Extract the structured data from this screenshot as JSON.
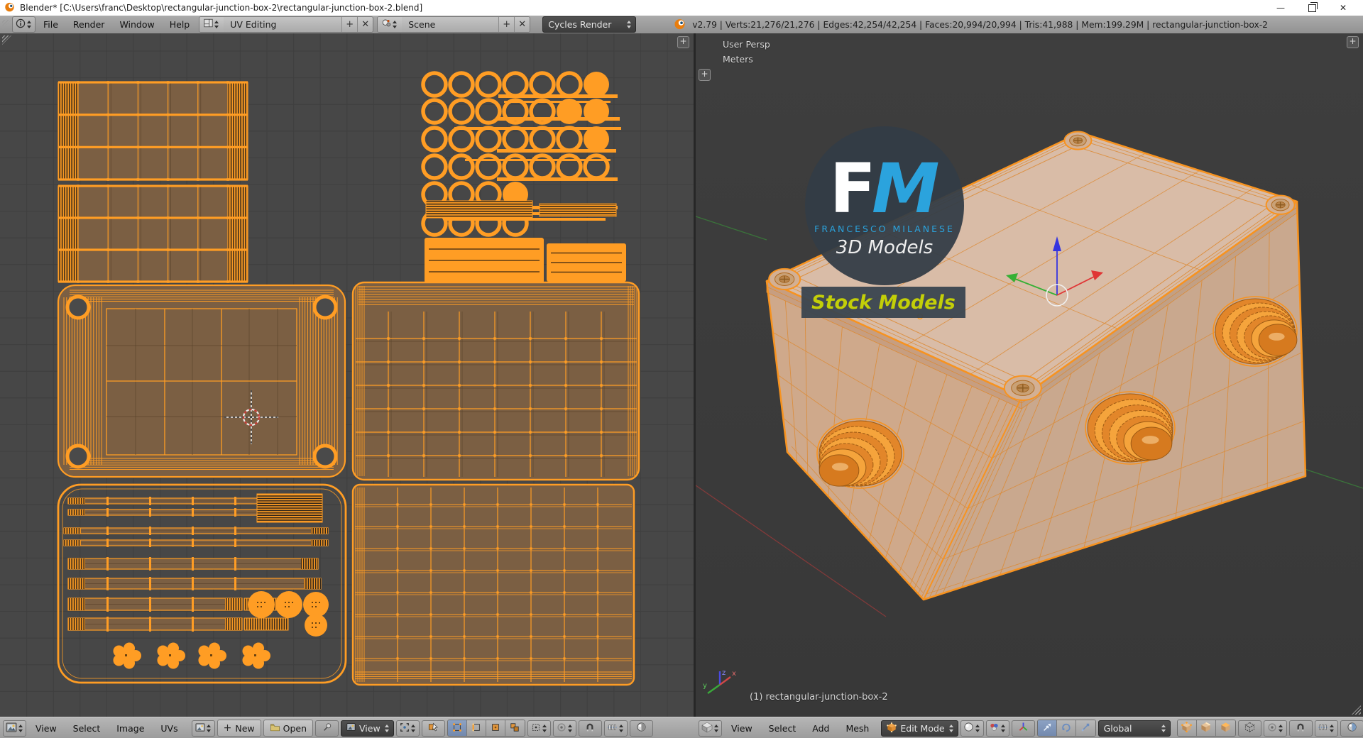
{
  "window": {
    "title": "Blender* [C:\\Users\\franc\\Desktop\\rectangular-junction-box-2\\rectangular-junction-box-2.blend]",
    "minimize_glyph": "—",
    "close_glyph": "✕"
  },
  "icons": {
    "plus_glyph": "+"
  },
  "info_header": {
    "menus": [
      "File",
      "Render",
      "Window",
      "Help"
    ],
    "layout_name": "UV Editing",
    "scene_name": "Scene",
    "engine": "Cycles Render",
    "add_glyph": "+",
    "close_glyph": "✕",
    "stats": "v2.79 | Verts:21,276/21,276 | Edges:42,254/42,254 | Faces:20,994/20,994 | Tris:41,988 | Mem:199.29M | rectangular-junction-box-2"
  },
  "uv_editor": {
    "menus": [
      "View",
      "Select",
      "Image",
      "UVs"
    ],
    "new_glyph": "+",
    "new_label": "New",
    "open_label": "Open",
    "mode_label": "View"
  },
  "viewport_3d": {
    "view_label": "User Persp",
    "units_label": "Meters",
    "object_label": "(1) rectangular-junction-box-2",
    "menus": [
      "View",
      "Select",
      "Add",
      "Mesh"
    ],
    "mode_label": "Edit Mode",
    "orientation_label": "Global",
    "axis_x": "x",
    "axis_y": "y",
    "axis_z": "z"
  },
  "watermark": {
    "initial_f": "F",
    "initial_m": "M",
    "name": "FRANCESCO MILANESE",
    "subtitle": "3D Models",
    "banner": "Stock Models"
  },
  "colors": {
    "accent_orange": "#ff9d24",
    "selection_blue": "#7d96bd",
    "watermark_blue": "#2ba3dd",
    "banner_yellow": "#c3cf08",
    "uv_background": "#474747",
    "viewport_background": "#3b3b3b"
  }
}
